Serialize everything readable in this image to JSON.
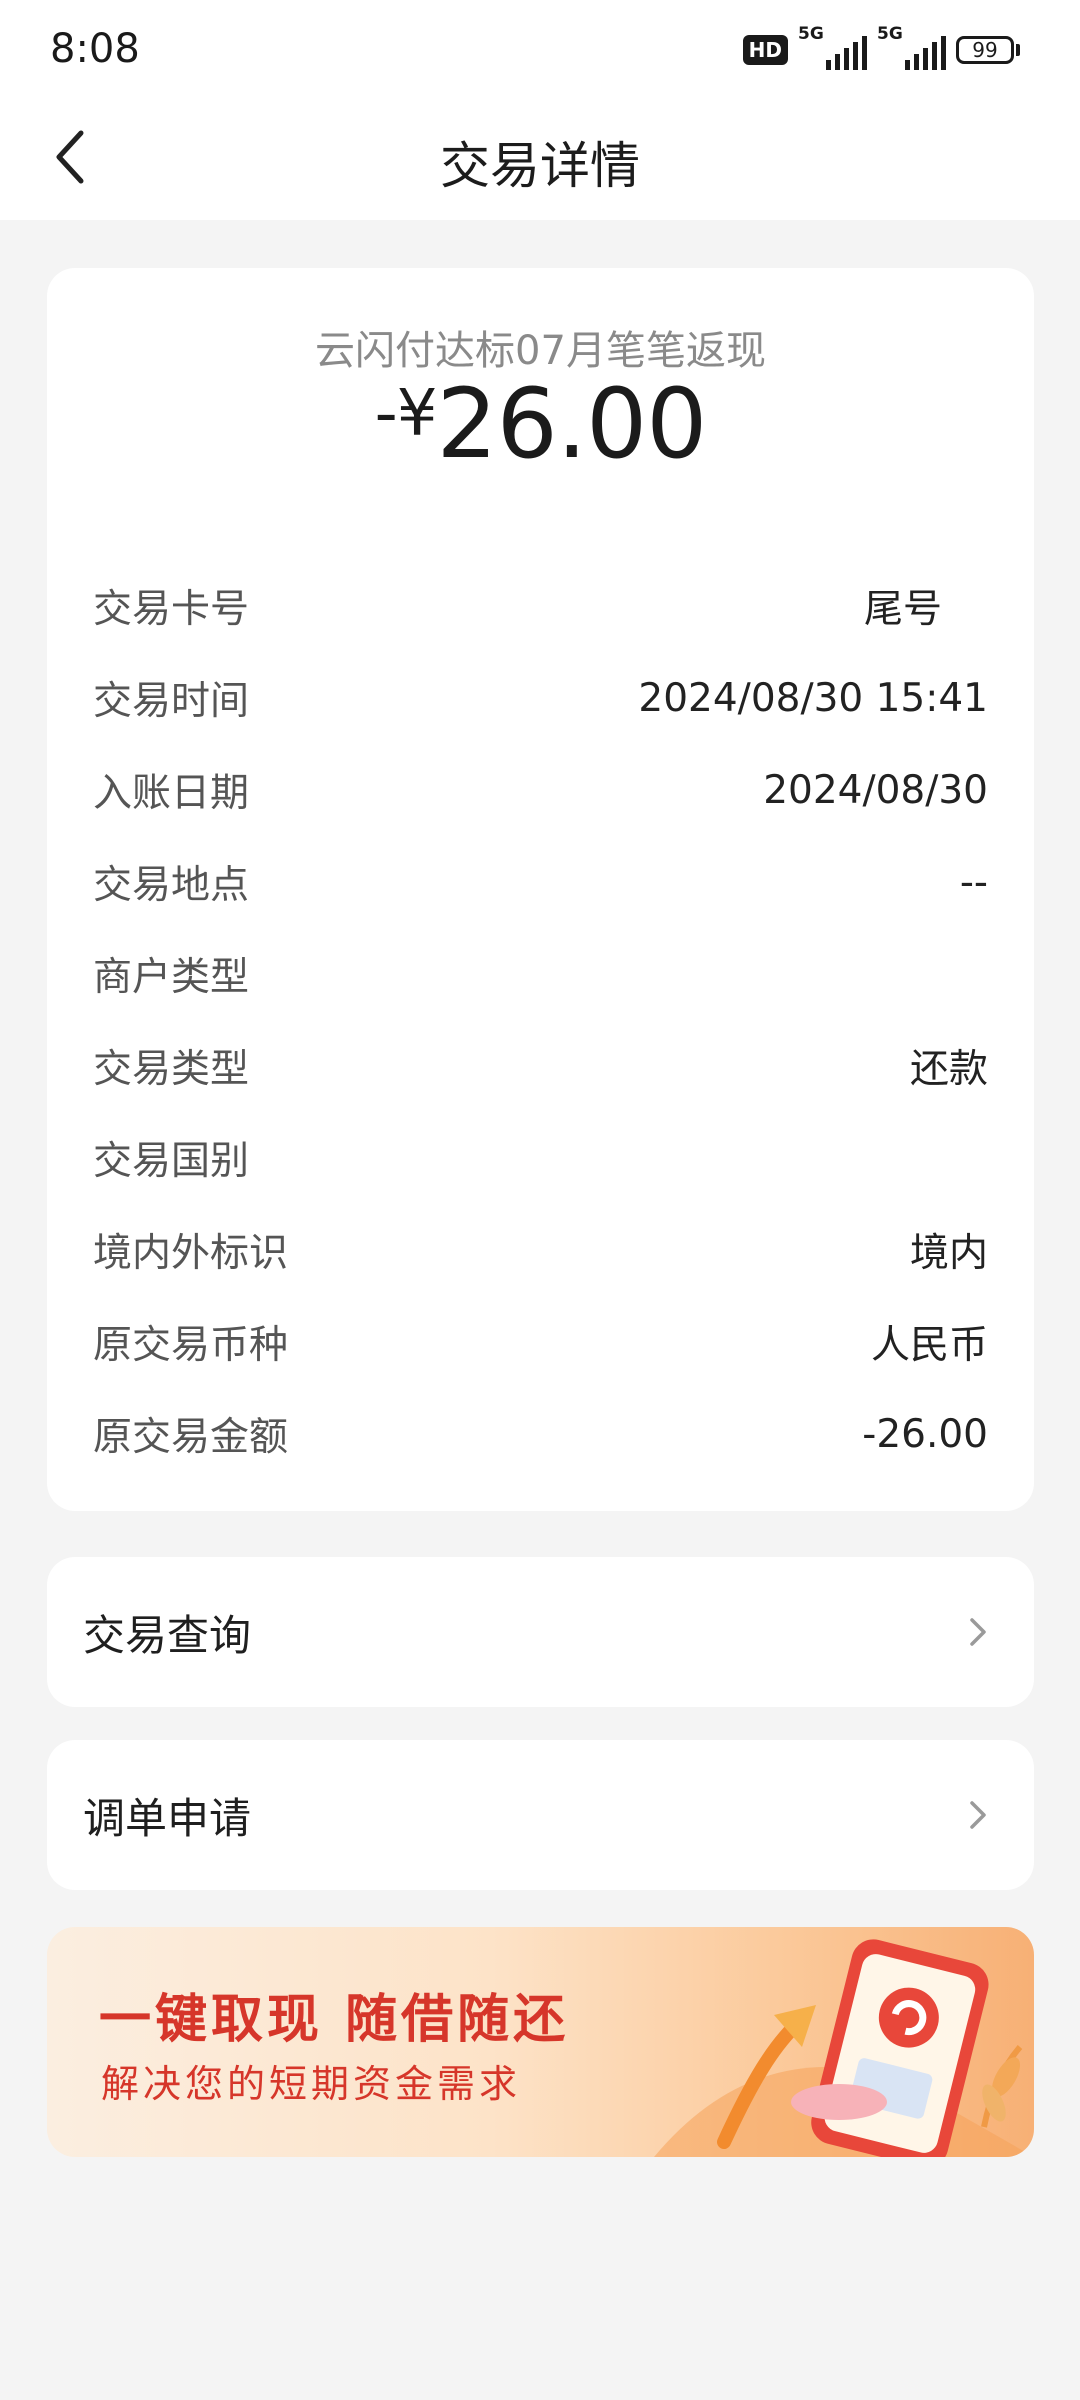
{
  "status_bar": {
    "time": "8:08",
    "hd_label": "HD",
    "network_1": "5G",
    "network_2": "5G",
    "battery": "99"
  },
  "header": {
    "title": "交易详情",
    "back_icon": "chevron-left-icon"
  },
  "transaction": {
    "merchant": "云闪付达标07月笔笔返现",
    "amount_sign": "-¥",
    "amount_value": "26.00",
    "details": [
      {
        "label": "交易卡号",
        "value": "尾号"
      },
      {
        "label": "交易时间",
        "value": "2024/08/30 15:41"
      },
      {
        "label": "入账日期",
        "value": "2024/08/30"
      },
      {
        "label": "交易地点",
        "value": "--"
      },
      {
        "label": "商户类型",
        "value": ""
      },
      {
        "label": "交易类型",
        "value": "还款"
      },
      {
        "label": "交易国别",
        "value": ""
      },
      {
        "label": "境内外标识",
        "value": "境内"
      },
      {
        "label": "原交易币种",
        "value": "人民币"
      },
      {
        "label": "原交易金额",
        "value": "-26.00"
      }
    ]
  },
  "menu": {
    "query_label": "交易查询",
    "dispute_label": "调单申请",
    "chevron_icon": "chevron-right-icon"
  },
  "banner": {
    "title": "一键取现 随借随还",
    "subtitle": "解决您的短期资金需求",
    "icon": "phone-cash-illustration-icon"
  },
  "colors": {
    "page_bg": "#f4f4f4",
    "card_bg": "#ffffff",
    "banner_text": "#d6362a",
    "muted_text": "#8a8a8a"
  }
}
